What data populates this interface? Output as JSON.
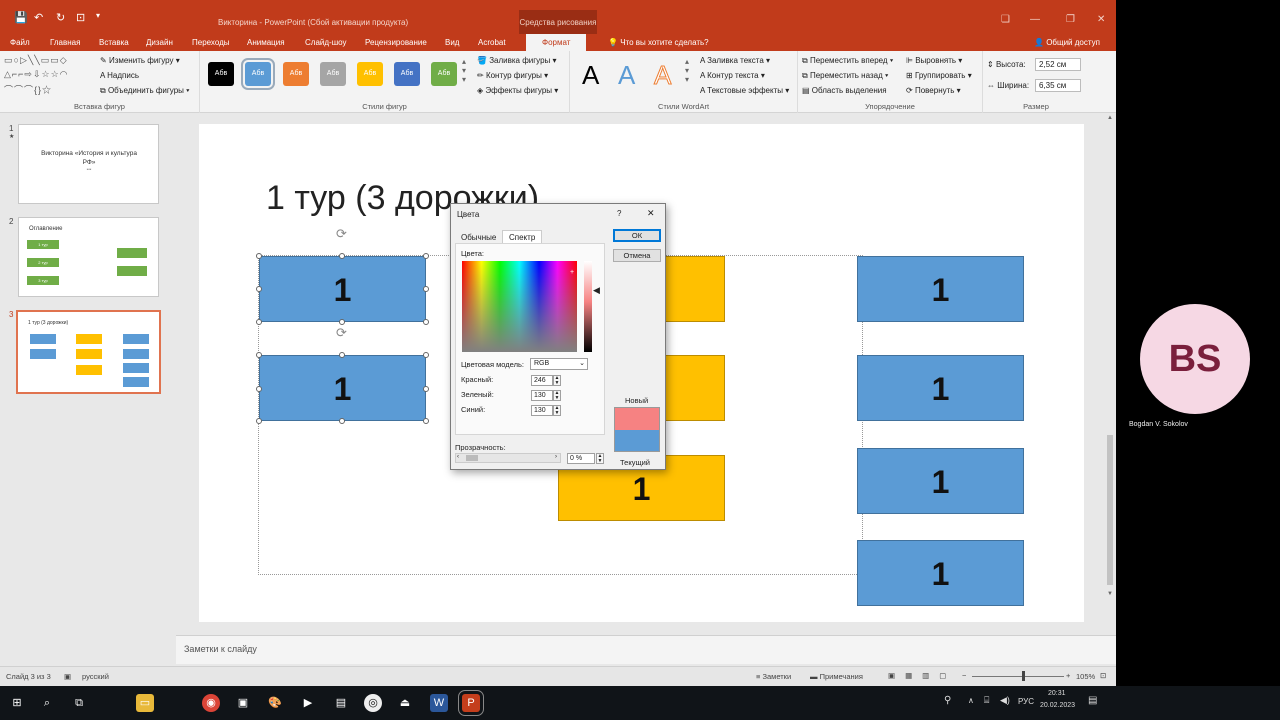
{
  "window": {
    "title": "Викторина - PowerPoint (Сбой активации продукта)",
    "context_tab": "Средства рисования",
    "min": "—",
    "max": "❐",
    "close": "✕",
    "restore": "❏"
  },
  "tabs": [
    "Файл",
    "Главная",
    "Вставка",
    "Дизайн",
    "Переходы",
    "Анимация",
    "Слайд-шоу",
    "Рецензирование",
    "Вид",
    "Acrobat",
    "Формат"
  ],
  "tell_me": "Что вы хотите сделать?",
  "share": "Общий доступ",
  "ribbon": {
    "insert_shapes": {
      "label": "Вставка фигур",
      "edit_shape": "Изменить фигуру",
      "textbox": "Надпись",
      "merge": "Объединить фигуры"
    },
    "shape_styles": {
      "label": "Стили фигур",
      "sample": "Абв",
      "fill": "Заливка фигуры",
      "outline": "Контур фигуры",
      "effects": "Эффекты фигуры"
    },
    "swatch_colors": [
      "#000000",
      "#5b9bd5",
      "#ed7d31",
      "#a5a5a5",
      "#ffc000",
      "#4472c4",
      "#70ad47"
    ],
    "wordart": {
      "label": "Стили WordArt",
      "letter": "A",
      "text_fill": "Заливка текста",
      "text_outline": "Контур текста",
      "text_effects": "Текстовые эффекты"
    },
    "arrange": {
      "label": "Упорядочение",
      "forward": "Переместить вперед",
      "backward": "Переместить назад",
      "selection": "Область выделения",
      "align": "Выровнять",
      "group": "Группировать",
      "rotate": "Повернуть"
    },
    "size": {
      "label": "Размер",
      "height_label": "Высота:",
      "height": "2,52 см",
      "width_label": "Ширина:",
      "width": "6,35 см"
    }
  },
  "thumbnails": [
    {
      "num": "1",
      "star": "★",
      "title": "Викторина «История и культура РФ»",
      "sub": "***"
    },
    {
      "num": "2",
      "title": "Оглавление",
      "items": [
        "1 тур",
        "2 тур",
        "3 тур"
      ]
    },
    {
      "num": "3",
      "title": "1 тур (3 дорожки)"
    }
  ],
  "slide": {
    "title": "1 тур (3 дорожки)",
    "box_label": "1"
  },
  "dialog": {
    "title": "Цвета",
    "help": "?",
    "close": "✕",
    "tab_standard": "Обычные",
    "tab_custom": "Спектр",
    "ok": "ОК",
    "cancel": "Отмена",
    "colors_label": "Цвета:",
    "model_label": "Цветовая модель:",
    "model": "RGB",
    "red_label": "Красный:",
    "red": "246",
    "green_label": "Зеленый:",
    "green": "130",
    "blue_label": "Синий:",
    "blue": "130",
    "transparency_label": "Прозрачность:",
    "transparency": "0 %",
    "new_label": "Новый",
    "current_label": "Текущий",
    "new_color": "#f68282",
    "current_color": "#5b9bd5"
  },
  "notes_placeholder": "Заметки к слайду",
  "status": {
    "slide": "Слайд 3 из 3",
    "lang": "русский",
    "notes": "Заметки",
    "comments": "Примечания",
    "zoom": "105%"
  },
  "presenter": {
    "initials": "BS",
    "name": "Bogdan V. Sokolov"
  },
  "taskbar": {
    "lang": "РУС",
    "time": "20:31",
    "date": "20.02.2023"
  }
}
